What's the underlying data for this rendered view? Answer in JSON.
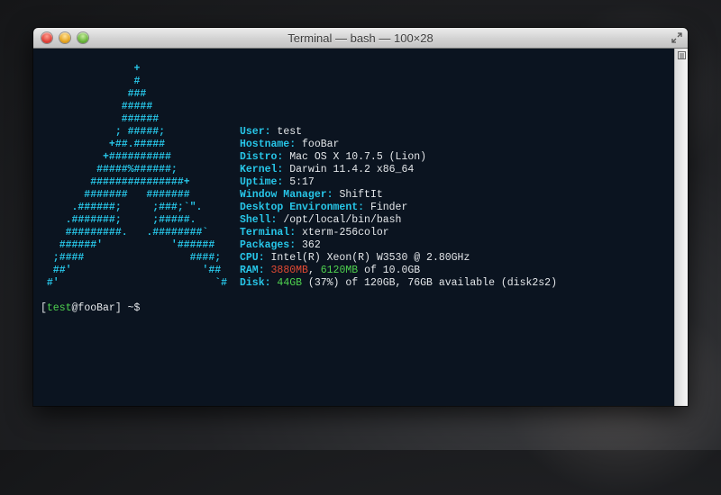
{
  "window": {
    "title": "Terminal — bash — 100×28"
  },
  "ascii_art": [
    "               +",
    "               #",
    "              ###",
    "             #####",
    "             ######",
    "            ; #####;",
    "           +##.#####",
    "          +##########",
    "         #####%######;",
    "        ###############+",
    "       #######   #######",
    "     .######;     ;###;`\".",
    "    .#######;     ;#####.",
    "    #########.   .########`",
    "   ######'           '######",
    "  ;####                 ####;",
    "  ##'                     '##",
    " #'                         `#"
  ],
  "info": {
    "user": {
      "label": "User:",
      "value": "test"
    },
    "hostname": {
      "label": "Hostname:",
      "value": "fooBar"
    },
    "distro": {
      "label": "Distro:",
      "value": "Mac OS X 10.7.5 (Lion)"
    },
    "kernel": {
      "label": "Kernel:",
      "value": "Darwin 11.4.2 x86_64"
    },
    "uptime": {
      "label": "Uptime:",
      "value": "5:17"
    },
    "wm": {
      "label": "Window Manager:",
      "value": "ShiftIt"
    },
    "de": {
      "label": "Desktop Environment:",
      "value": "Finder"
    },
    "shell": {
      "label": "Shell:",
      "value": "/opt/local/bin/bash"
    },
    "terminal": {
      "label": "Terminal:",
      "value": "xterm-256color"
    },
    "packages": {
      "label": "Packages:",
      "value": "362"
    },
    "cpu": {
      "label": "CPU:",
      "value": "Intel(R) Xeon(R) W3530 @ 2.80GHz"
    },
    "ram": {
      "label": "RAM:",
      "used": "3880MB",
      "sep": ", ",
      "free": "6120MB",
      "rest": " of 10.0GB"
    },
    "disk": {
      "label": "Disk:",
      "used": "44GB",
      "rest": " (37%) of 120GB, 76GB available (disk2s2)"
    }
  },
  "prompt": {
    "open": "[",
    "user": "test",
    "host": "@fooBar",
    "rest": "] ~$"
  },
  "colors": {
    "background": "#0b1420",
    "accent": "#27c6e8",
    "ram_used": "#e34a33",
    "ram_free": "#4fd24f",
    "prompt_user": "#4fd24f"
  }
}
